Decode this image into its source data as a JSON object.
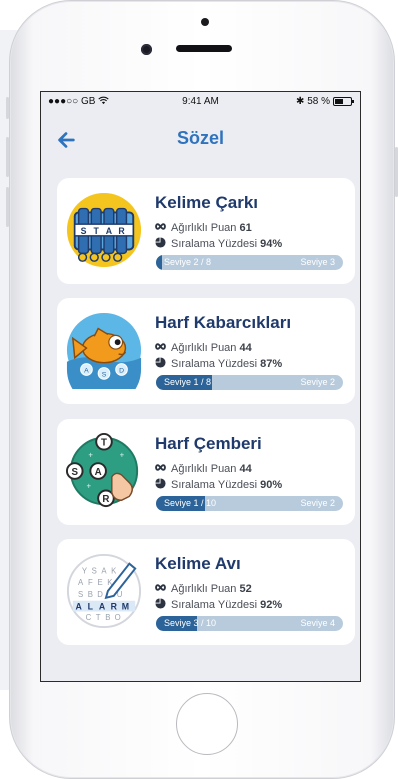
{
  "status_bar": {
    "carrier": "●●●○○ GB",
    "time": "9:41 AM",
    "battery_text": "58 %",
    "battery_level": 0.58
  },
  "nav": {
    "back_icon": "arrow-left-icon",
    "title": "Sözel"
  },
  "stat_labels": {
    "weighted_points": "Ağırlıklı Puan",
    "ranking_percent": "Sıralama Yüzdesi"
  },
  "colors": {
    "accent": "#2e73bd",
    "progress_fill": "#2c6499",
    "progress_track": "#b8cbdd",
    "card_title": "#1f3a6b"
  },
  "games": [
    {
      "name": "Kelime Çarkı",
      "icon": "word-wheel-icon",
      "weighted_points": "61",
      "ranking_percent": "94%",
      "level_current": "Seviye  2 / 8",
      "level_next": "Seviye  3",
      "progress": 0.03
    },
    {
      "name": "Harf Kabarcıkları",
      "icon": "bubble-fish-icon",
      "weighted_points": "44",
      "ranking_percent": "87%",
      "level_current": "Seviye  1 / 8",
      "level_next": "Seviye  2",
      "progress": 0.3
    },
    {
      "name": "Harf Çemberi",
      "icon": "letter-circle-icon",
      "weighted_points": "44",
      "ranking_percent": "90%",
      "level_current": "Seviye  1 / 10",
      "level_next": "Seviye  2",
      "progress": 0.26
    },
    {
      "name": "Kelime Avı",
      "icon": "word-search-icon",
      "weighted_points": "52",
      "ranking_percent": "92%",
      "level_current": "Seviye  3 / 10",
      "level_next": "Seviye  4",
      "progress": 0.22
    }
  ]
}
